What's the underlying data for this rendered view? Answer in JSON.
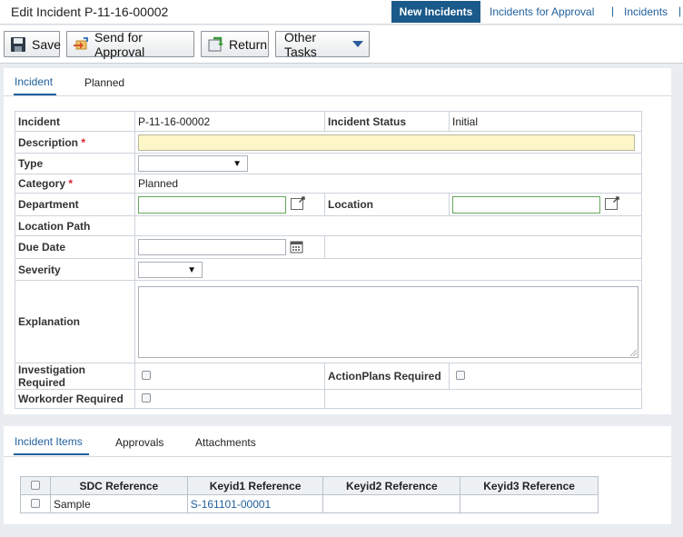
{
  "header": {
    "title": "Edit Incident P-11-16-00002",
    "nav": [
      {
        "label": "New Incidents",
        "active": true
      },
      {
        "label": "Incidents for Approval",
        "active": false
      },
      {
        "label": "Incidents",
        "active": false
      }
    ],
    "separator": "|"
  },
  "toolbar": {
    "save_label": "Save",
    "send_label": "Send for Approval",
    "return_label": "Return",
    "other_label": "Other Tasks"
  },
  "form_tabs": [
    "Incident",
    "Planned"
  ],
  "form": {
    "incident_label": "Incident",
    "incident_value": "P-11-16-00002",
    "status_label": "Incident Status",
    "status_value": "Initial",
    "description_label": "Description",
    "description_value": "",
    "type_label": "Type",
    "type_value": "",
    "category_label": "Category",
    "category_value": "Planned",
    "department_label": "Department",
    "department_value": "",
    "location_label": "Location",
    "location_value": "",
    "location_path_label": "Location Path",
    "due_date_label": "Due Date",
    "due_date_value": "",
    "severity_label": "Severity",
    "severity_value": "",
    "explanation_label": "Explanation",
    "explanation_value": "",
    "investigation_label": "Investigation Required",
    "actionplans_label": "ActionPlans Required",
    "workorder_label": "Workorder Required",
    "required_marker": "*",
    "dropdown_arrow": "▼"
  },
  "bottom_tabs": [
    "Incident Items",
    "Approvals",
    "Attachments"
  ],
  "items_table": {
    "columns": [
      "SDC Reference",
      "Keyid1 Reference",
      "Keyid2 Reference",
      "Keyid3 Reference"
    ],
    "rows": [
      {
        "sdc": "Sample",
        "keyid1": "S-161101-00001",
        "keyid2": "",
        "keyid3": ""
      }
    ]
  },
  "colors": {
    "accent": "#1a5a8a",
    "link": "#1f5f9c",
    "required": "#d9232d",
    "input_highlight": "#fdf6c7"
  },
  "icons": [
    "save-icon",
    "send-icon",
    "return-icon",
    "chevron-down-icon",
    "external-link-icon",
    "calendar-icon"
  ]
}
